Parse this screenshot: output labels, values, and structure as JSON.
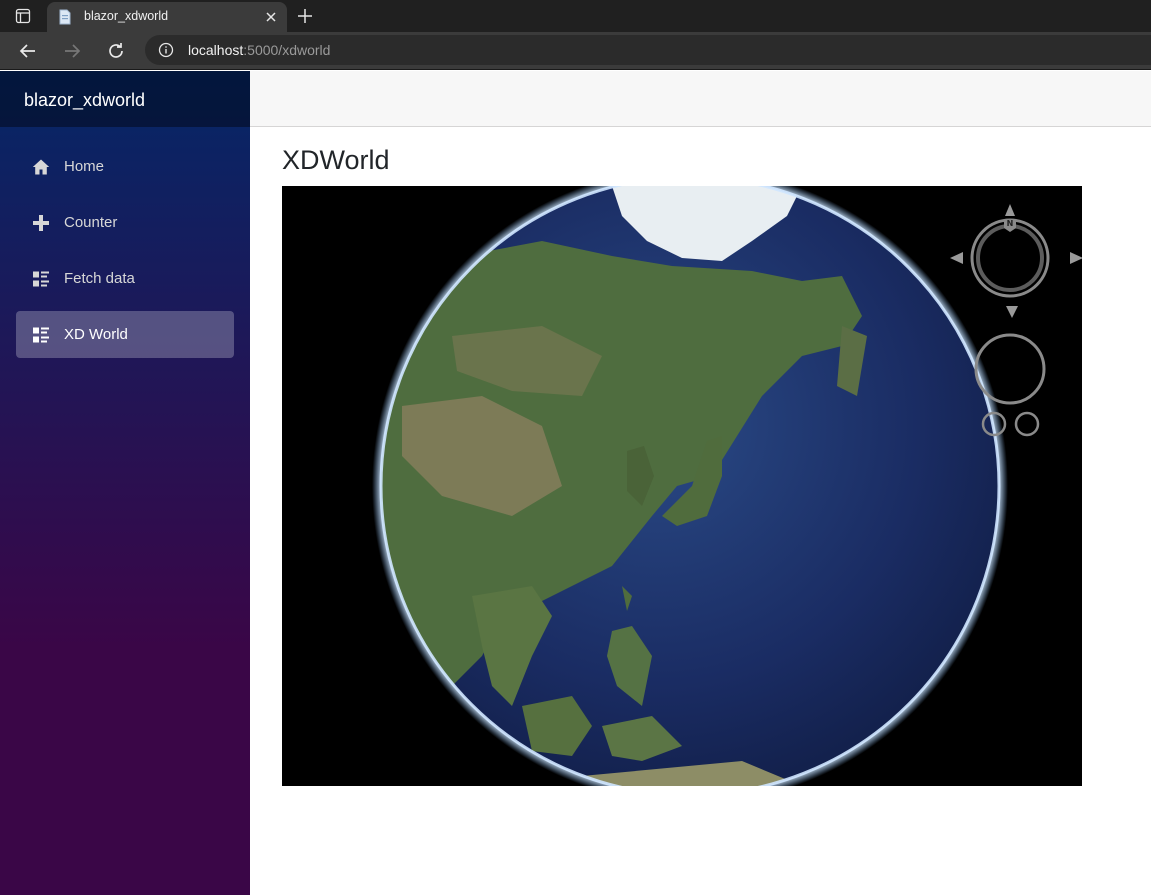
{
  "browser": {
    "tab_title": "blazor_xdworld",
    "url_host": "localhost",
    "url_rest": ":5000/xdworld"
  },
  "sidebar": {
    "brand": "blazor_xdworld",
    "items": [
      {
        "label": "Home",
        "icon": "home-icon"
      },
      {
        "label": "Counter",
        "icon": "plus-icon"
      },
      {
        "label": "Fetch data",
        "icon": "list-icon"
      },
      {
        "label": "XD World",
        "icon": "list-icon",
        "active": true
      }
    ]
  },
  "main": {
    "title": "XDWorld"
  },
  "colors": {
    "sidebar_top": "#052767",
    "sidebar_bottom": "#3a0647",
    "ocean": "#1b2f68",
    "land": "#4f6d3f",
    "atmosphere": "#8fc3ff"
  }
}
